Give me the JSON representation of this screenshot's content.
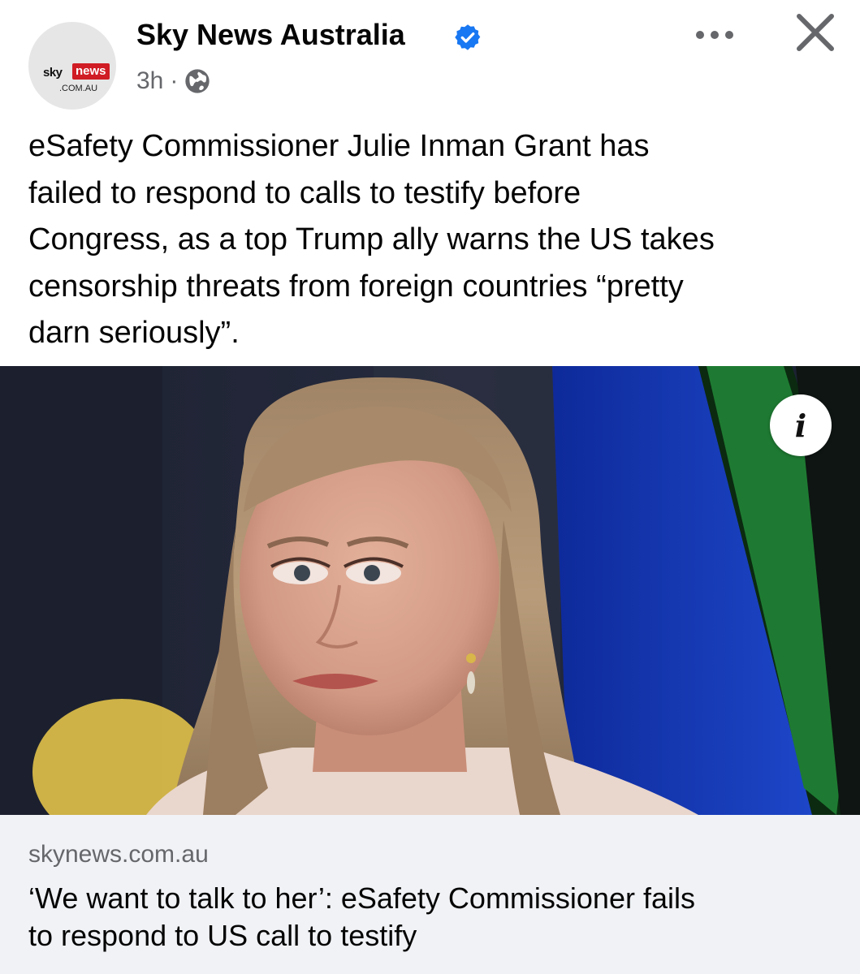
{
  "header": {
    "page_name": "Sky News Australia",
    "time": "3h",
    "separator": "·",
    "avatar_logo": {
      "sky": "sky",
      "news": "news",
      "domain": ".COM.AU"
    },
    "icons": [
      "verified-badge-icon",
      "globe-icon",
      "more-options-icon",
      "close-icon"
    ]
  },
  "post": {
    "lines": [
      "eSafety Commissioner Julie Inman Grant has",
      "failed to respond to calls to testify before",
      "Congress, as a top Trump ally warns the US takes",
      "censorship threats from foreign countries “pretty",
      "darn seriously”."
    ]
  },
  "image": {
    "info_label": "i"
  },
  "link_preview": {
    "domain": "skynews.com.au",
    "title_lines": [
      "‘We want to talk to her’: eSafety Commissioner fails",
      "to respond to US call to testify"
    ]
  },
  "colors": {
    "verified": "#1877f2",
    "secondary_text": "#65676b",
    "preview_bg": "#f0f2f5",
    "logo_red": "#d01c24"
  }
}
